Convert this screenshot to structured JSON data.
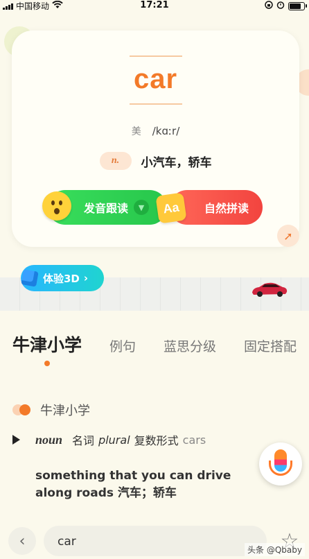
{
  "status_bar": {
    "carrier": "中国移动",
    "time": "17:21"
  },
  "word_card": {
    "word": "car",
    "region": "美",
    "phonetic": "/kɑːr/",
    "pos": "n.",
    "meaning": "小汽车，轿车",
    "follow_read_label": "发音跟读",
    "phonics_label": "自然拼读",
    "phonics_icon_text": "Aa"
  },
  "three_d_button": {
    "label": "体验3D"
  },
  "tabs": [
    "牛津小学",
    "例句",
    "蓝思分级",
    "固定搭配"
  ],
  "active_tab_index": 0,
  "section": {
    "title": "牛津小学",
    "noun": "noun",
    "pos_cn": "名词",
    "plural_label": "plural",
    "plural_cn": "复数形式",
    "plural_form": "cars",
    "example": "something that you can drive along roads 汽车；轿车"
  },
  "search": {
    "value": "car"
  },
  "watermark": "头条 @Qbaby",
  "colors": {
    "accent": "#f37a29",
    "green": "#2fd155",
    "red": "#f7504a",
    "blue": "#29b6ff"
  }
}
